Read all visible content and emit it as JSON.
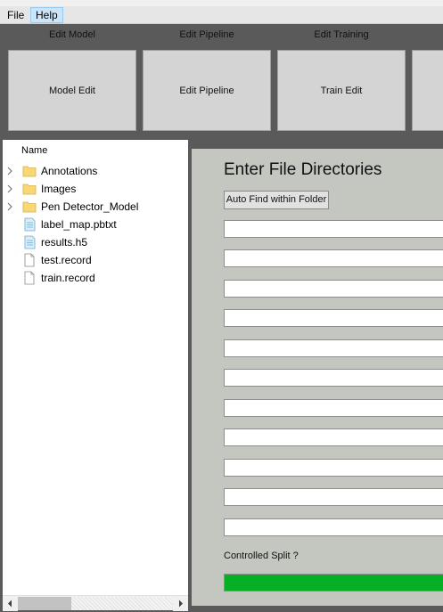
{
  "menubar": {
    "file": "File",
    "help": "Help"
  },
  "toolbar": {
    "captions": [
      "Edit Model",
      "Edit Pipeline",
      "Edit Training"
    ],
    "buttons": [
      "Model Edit",
      "Edit Pipeline",
      "Train Edit"
    ]
  },
  "tree": {
    "header": "Name",
    "items": [
      {
        "label": "Annotations",
        "icon": "folder-icon",
        "expandable": true
      },
      {
        "label": "Images",
        "icon": "folder-icon",
        "expandable": true
      },
      {
        "label": "Pen Detector_Model",
        "icon": "folder-icon",
        "expandable": true
      },
      {
        "label": "label_map.pbtxt",
        "icon": "text-file-icon",
        "expandable": false
      },
      {
        "label": "results.h5",
        "icon": "text-file-icon",
        "expandable": false
      },
      {
        "label": "test.record",
        "icon": "file-icon",
        "expandable": false
      },
      {
        "label": "train.record",
        "icon": "file-icon",
        "expandable": false
      }
    ]
  },
  "form": {
    "title": "Enter File Directories",
    "auto_find_label": "Auto Find within Folder",
    "inputs": [
      "",
      "",
      "",
      "",
      "",
      "",
      "",
      "",
      "",
      "",
      ""
    ],
    "split_label": "Controlled Split ?",
    "progress": 1.0
  },
  "colors": {
    "accent": "#06b025",
    "panel": "#c4c6c0",
    "frame": "#5a5a5a"
  }
}
